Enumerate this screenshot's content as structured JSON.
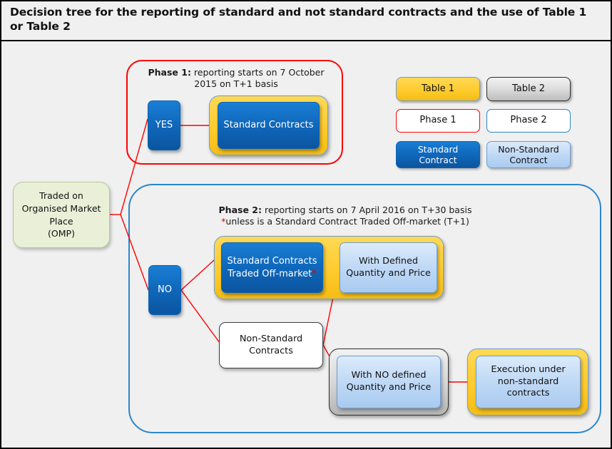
{
  "title": "Decision tree for the reporting of standard and not standard contracts and the use of Table 1 or Table 2",
  "phase1": {
    "label_bold": "Phase 1:",
    "label_rest": " reporting starts on 7 October 2015 on T+1 basis",
    "nodes": {
      "yes": "YES",
      "standard_contracts": "Standard Contracts"
    }
  },
  "phase2": {
    "label_bold": "Phase 2:",
    "label_rest": " reporting starts on 7 April 2016 on T+30 basis",
    "footnote_asterisk": "*",
    "footnote_rest": "unless is a Standard Contract Traded Off-market (T+1)",
    "nodes": {
      "no": "NO",
      "standard_offmarket_line1": "Standard Contracts",
      "standard_offmarket_line2": "Traded Off-market",
      "standard_offmarket_asterisk": "*",
      "with_defined_line1": "With Defined",
      "with_defined_line2": "Quantity and Price",
      "non_standard_line1": "Non-Standard",
      "non_standard_line2": "Contracts",
      "with_no_defined_line1": "With NO defined",
      "with_no_defined_line2": "Quantity and Price",
      "execution_line1": "Execution under",
      "execution_line2": "non-standard",
      "execution_line3": "contracts"
    }
  },
  "root": {
    "line1": "Traded on",
    "line2": "Organised Market",
    "line3": "Place",
    "line4": "(OMP)"
  },
  "legend": {
    "table1": "Table 1",
    "table2": "Table 2",
    "phase1": "Phase 1",
    "phase2": "Phase 2",
    "standard_line1": "Standard",
    "standard_line2": "Contract",
    "nonstandard_line1": "Non-Standard",
    "nonstandard_line2": "Contract"
  },
  "colors": {
    "table1_yellow": "#FFCB2E",
    "table2_grey": "#D8D8D8",
    "phase1_red": "#FF0000",
    "phase2_blue": "#2B86CC",
    "standard_blue": "#1069BD",
    "nonstandard_lightblue": "#C2DAF6",
    "omp_green": "#E9F0D7",
    "connector_red": "#FF0000",
    "background": "#F0F0F0"
  }
}
